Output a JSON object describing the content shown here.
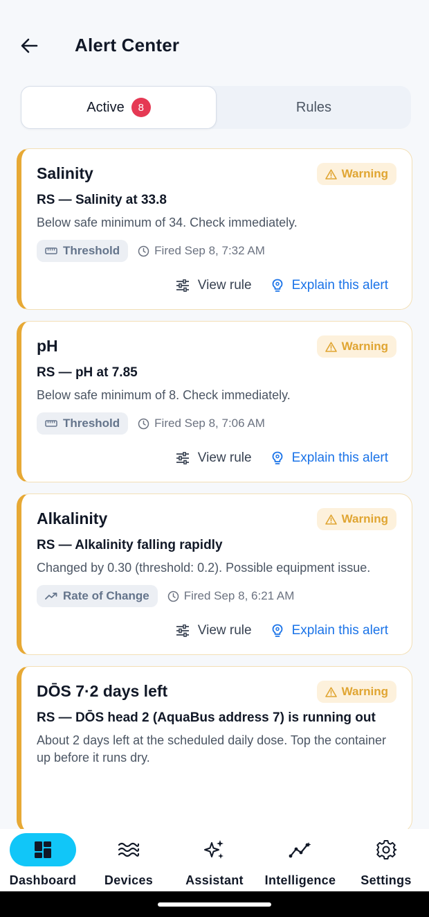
{
  "header": {
    "title": "Alert Center"
  },
  "tabs": [
    {
      "label": "Active",
      "badge": "8"
    },
    {
      "label": "Rules"
    }
  ],
  "alerts": [
    {
      "title": "Salinity",
      "severity": "Warning",
      "headline": "RS — Salinity at 33.8",
      "description": "Below safe minimum of 34. Check immediately.",
      "type": "Threshold",
      "fired": "Fired Sep 8, 7:32 AM",
      "view_rule": "View rule",
      "explain": "Explain this alert"
    },
    {
      "title": "pH",
      "severity": "Warning",
      "headline": "RS — pH at 7.85",
      "description": "Below safe minimum of 8. Check immediately.",
      "type": "Threshold",
      "fired": "Fired Sep 8, 7:06 AM",
      "view_rule": "View rule",
      "explain": "Explain this alert"
    },
    {
      "title": "Alkalinity",
      "severity": "Warning",
      "headline": "RS — Alkalinity falling rapidly",
      "description": "Changed by 0.30 (threshold: 0.2). Possible equipment issue.",
      "type": "Rate of Change",
      "fired": "Fired Sep 8, 6:21 AM",
      "view_rule": "View rule",
      "explain": "Explain this alert"
    },
    {
      "title": "DŌS 7·2 days left",
      "severity": "Warning",
      "headline": "RS — DŌS head 2 (AquaBus address 7) is running out",
      "description": "About 2 days left at the scheduled daily dose. Top the container up before it runs dry."
    }
  ],
  "nav": [
    {
      "label": "Dashboard",
      "icon": "dashboard-icon",
      "active": true
    },
    {
      "label": "Devices",
      "icon": "waves-icon"
    },
    {
      "label": "Assistant",
      "icon": "sparkles-icon"
    },
    {
      "label": "Intelligence",
      "icon": "trend-icon"
    },
    {
      "label": "Settings",
      "icon": "gear-icon"
    }
  ],
  "colors": {
    "warning_accent": "#e7a935",
    "warning_pill_bg": "#fdf1dc",
    "link_blue": "#1a73e8",
    "badge_red": "#e53954",
    "nav_active": "#11c6f8"
  }
}
